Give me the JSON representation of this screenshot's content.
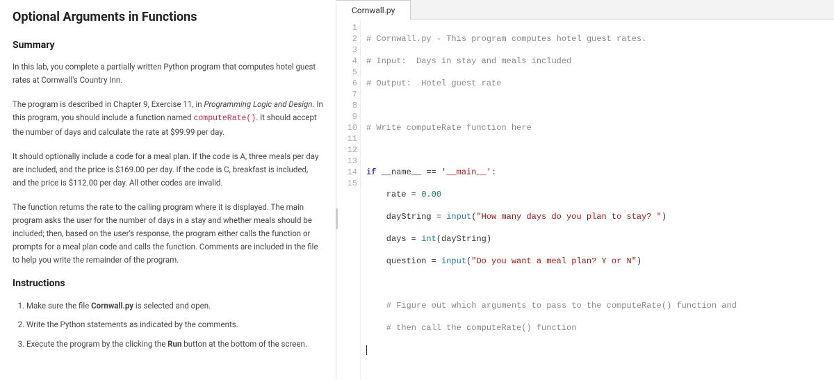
{
  "left": {
    "title": "Optional Arguments in Functions",
    "summary_heading": "Summary",
    "para1_a": "In this lab, you complete a partially written Python program that computes hotel guest rates at Cornwall's Country Inn.",
    "para2_a": "The program is described in Chapter 9, Exercise 11, in ",
    "para2_b": "Programming Logic and Design",
    "para2_c": ". In this program, you should include a function named ",
    "para2_code": "computeRate()",
    "para2_d": ". It should accept the number of days and calculate the rate at $99.99 per day.",
    "para3": "It should optionally include a code for a meal plan. If the code is A, three meals per day are included, and the price is $169.00 per day. If the code is C, breakfast is included, and the price is $112.00 per day. All other codes are invalid.",
    "para4": "The function returns the rate to the calling program where it is displayed. The main program asks the user for the number of days in a stay and whether meals should be included; then, based on the user's response, the program either calls the function or prompts for a meal plan code and calls the function. Comments are included in the file to help you write the remainder of the program.",
    "instructions_heading": "Instructions",
    "instr1_a": "Make sure the file ",
    "instr1_b": "Cornwall.py",
    "instr1_c": " is selected and open.",
    "instr2": "Write the Python statements as indicated by the comments.",
    "instr3_a": "Execute the program by the clicking the ",
    "instr3_b": "Run",
    "instr3_c": " button at the bottom of the screen."
  },
  "editor": {
    "tab_label": "Cornwall.py",
    "gutter": [
      "1",
      "2",
      "3",
      "4",
      "5",
      "6",
      "7",
      "8",
      "9",
      "10",
      "11",
      "12",
      "13",
      "14",
      "15"
    ],
    "lines": {
      "l1_c": "# Cornwall.py - This program computes hotel guest rates.",
      "l2_c": "# Input:  Days in stay and meals included",
      "l3_c": "# Output:  Hotel guest rate",
      "l5_c": "# Write computeRate function here",
      "l7_kw": "if",
      "l7_a": " __name__ == ",
      "l7_s": "'__main__'",
      "l7_b": ":",
      "l8_a": "    rate = ",
      "l8_n": "0.00",
      "l9_a": "    dayString = ",
      "l9_fn": "input",
      "l9_b": "(",
      "l9_s": "\"How many days do you plan to stay? \"",
      "l9_c": ")",
      "l10_a": "    days = ",
      "l10_fn": "int",
      "l10_b": "(dayString)",
      "l11_a": "    question = ",
      "l11_fn": "input",
      "l11_b": "(",
      "l11_s": "\"Do you want a meal plan? Y or N\"",
      "l11_c": ")",
      "l13_c": "    # Figure out which arguments to pass to the computeRate() function and",
      "l14_c": "    # then call the computeRate() function"
    }
  }
}
